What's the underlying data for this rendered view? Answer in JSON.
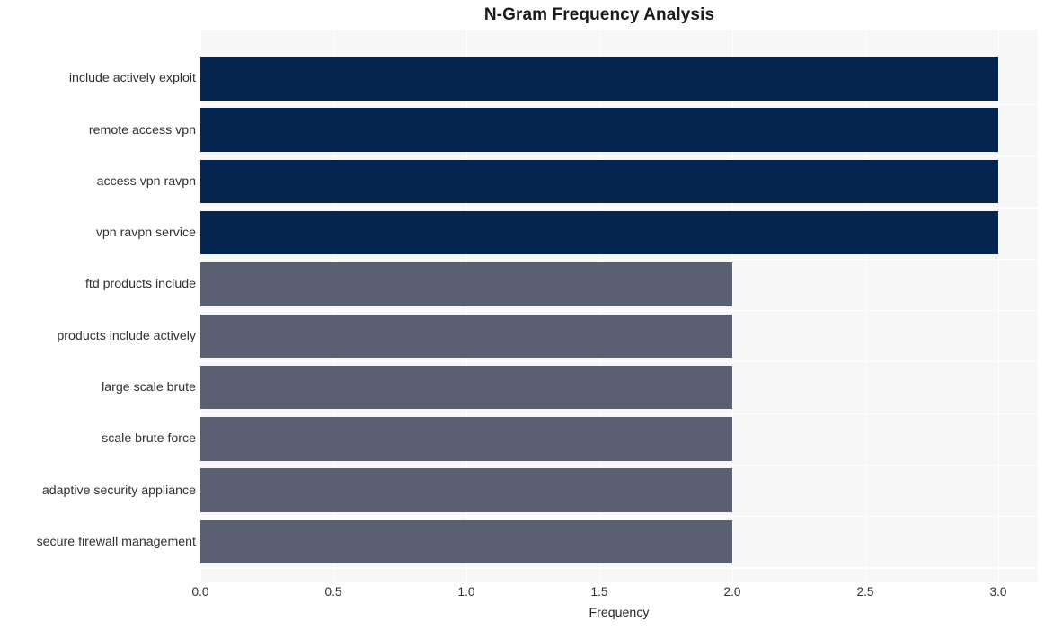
{
  "chart_data": {
    "type": "bar",
    "orientation": "horizontal",
    "title": "N-Gram Frequency Analysis",
    "xlabel": "Frequency",
    "ylabel": "",
    "xlim": [
      0,
      3.0
    ],
    "xticks": [
      "0.0",
      "0.5",
      "1.0",
      "1.5",
      "2.0",
      "2.5",
      "3.0"
    ],
    "xtick_values": [
      0,
      0.5,
      1.0,
      1.5,
      2.0,
      2.5,
      3.0
    ],
    "grid": true,
    "legend": "none",
    "categories": [
      "include actively exploit",
      "remote access vpn",
      "access vpn ravpn",
      "vpn ravpn service",
      "ftd products include",
      "products include actively",
      "large scale brute",
      "scale brute force",
      "adaptive security appliance",
      "secure firewall management"
    ],
    "values": [
      3,
      3,
      3,
      3,
      2,
      2,
      2,
      2,
      2,
      2
    ],
    "bar_colors": [
      "#04254f",
      "#04254f",
      "#04254f",
      "#04254f",
      "#5a5f72",
      "#5a5f72",
      "#5a5f72",
      "#5a5f72",
      "#5a5f72",
      "#5a5f72"
    ]
  },
  "style": {
    "figure_background": "#ffffff",
    "plot_background": "#f7f7f8",
    "grid_color": "#ffffff",
    "title_color": "#1a1a1a",
    "tick_color": "#303030",
    "accent_high": "#04254f",
    "accent_low": "#5a5f72"
  }
}
